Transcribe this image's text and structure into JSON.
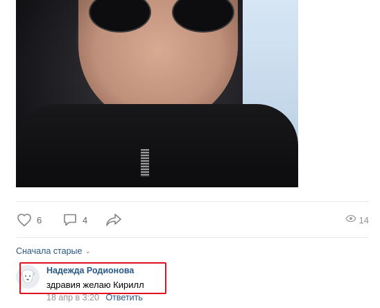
{
  "post": {
    "photo_alt": "person in black hoodie and sunglasses",
    "likes": "6",
    "comments": "4",
    "views": "14"
  },
  "comments_section": {
    "sort_label": "Сначала старые",
    "items": [
      {
        "author": "Надежда Родионова",
        "text": "здравия желаю Кирилл",
        "date": "18 апр в 3:20",
        "reply_label": "Ответить"
      }
    ]
  },
  "colors": {
    "link": "#2a5885",
    "muted": "#939393",
    "icon": "#828282",
    "highlight": "#e0101c"
  }
}
